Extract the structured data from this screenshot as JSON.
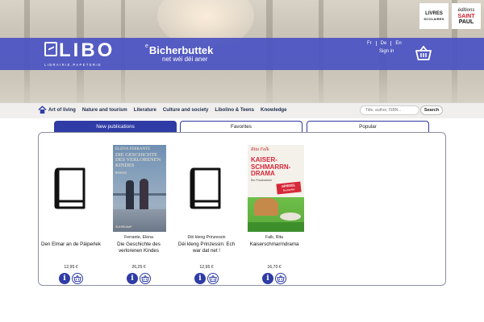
{
  "header": {
    "logo_word": "LIBO",
    "logo_sub": "LIBRAIRIE.PAPETERIE",
    "tagline_prefix": "e",
    "tagline_main": "Bicherbuttek",
    "tagline_sub": "net wéi déi aner",
    "languages": [
      "Fr",
      "De",
      "En"
    ],
    "signin": "Sign in",
    "partner_1": {
      "line1": "LIVRES",
      "line2": "SCOLAIRES"
    },
    "partner_2": {
      "line1": "éditions",
      "line2": "SAINT",
      "line3": "PAUL"
    }
  },
  "nav": {
    "items": [
      "Art of living",
      "Nature and tourism",
      "Literature",
      "Culture and society",
      "Libolino & Teens",
      "Knowledge"
    ],
    "search_placeholder": "Title, author, ISBN...",
    "search_button": "Search"
  },
  "tabs": [
    {
      "label": "New publications",
      "active": true
    },
    {
      "label": "Favorites",
      "active": false
    },
    {
      "label": "Popular",
      "active": false
    }
  ],
  "books": [
    {
      "author": "",
      "title": "Den Elmar an de Päiperlek",
      "price": "12,95 €",
      "cover": "placeholder"
    },
    {
      "author": "Ferrante, Elena",
      "title": "Die Geschichte des verlorenen Kindes",
      "price": "26,25 €",
      "cover": "ferrante",
      "cover_text": {
        "author": "ELENA FERRANTE",
        "title": "DIE GESCHICHTE DES VERLORENEN KINDES",
        "genre": "ROMAN",
        "publisher": "SUHRKAMP"
      }
    },
    {
      "author": "Déi kleng Prinzessin",
      "title": "Déi kleng Prinzessin: Ech war dat net !",
      "price": "12,95 €",
      "cover": "placeholder"
    },
    {
      "author": "Falk, Rita",
      "title": "Kaiserschmarrndrama",
      "price": "16,70 €",
      "cover": "falk",
      "cover_text": {
        "author": "Rita Falk",
        "title_1": "KAISER-",
        "title_2": "SCHMARRN-",
        "title_3": "DRAMA",
        "genre": "Ein Provinzkrimi",
        "sticker_1": "SPIEGEL",
        "sticker_2": "Bestseller"
      }
    }
  ],
  "colors": {
    "primary": "#2f3ca6",
    "band": "#4a53c2",
    "nav_bg": "#f0efee",
    "panel_border": "#8c8fa3"
  },
  "icons": {
    "info": "info-icon",
    "cart": "basket-icon",
    "home": "home-icon",
    "placeholder": "book-icon"
  }
}
